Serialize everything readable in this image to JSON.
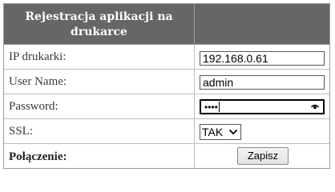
{
  "header": {
    "title_line1": "Rejestracja aplikacji na",
    "title_line2": "drukarce"
  },
  "fields": {
    "ip": {
      "label": "IP drukarki:",
      "value": "192.168.0.61"
    },
    "username": {
      "label": "User Name:",
      "value": "admin"
    },
    "password": {
      "label": "Password:",
      "masked_value": "••••",
      "visibility_icon": "eye-icon"
    },
    "ssl": {
      "label": "SSL:",
      "selected": "TAK"
    },
    "connection": {
      "label": "Połączenie:",
      "button_label": "Zapisz"
    }
  },
  "colors": {
    "header_bg": "#666666",
    "header_text": "#ffffff",
    "border": "#bdbdbd"
  }
}
